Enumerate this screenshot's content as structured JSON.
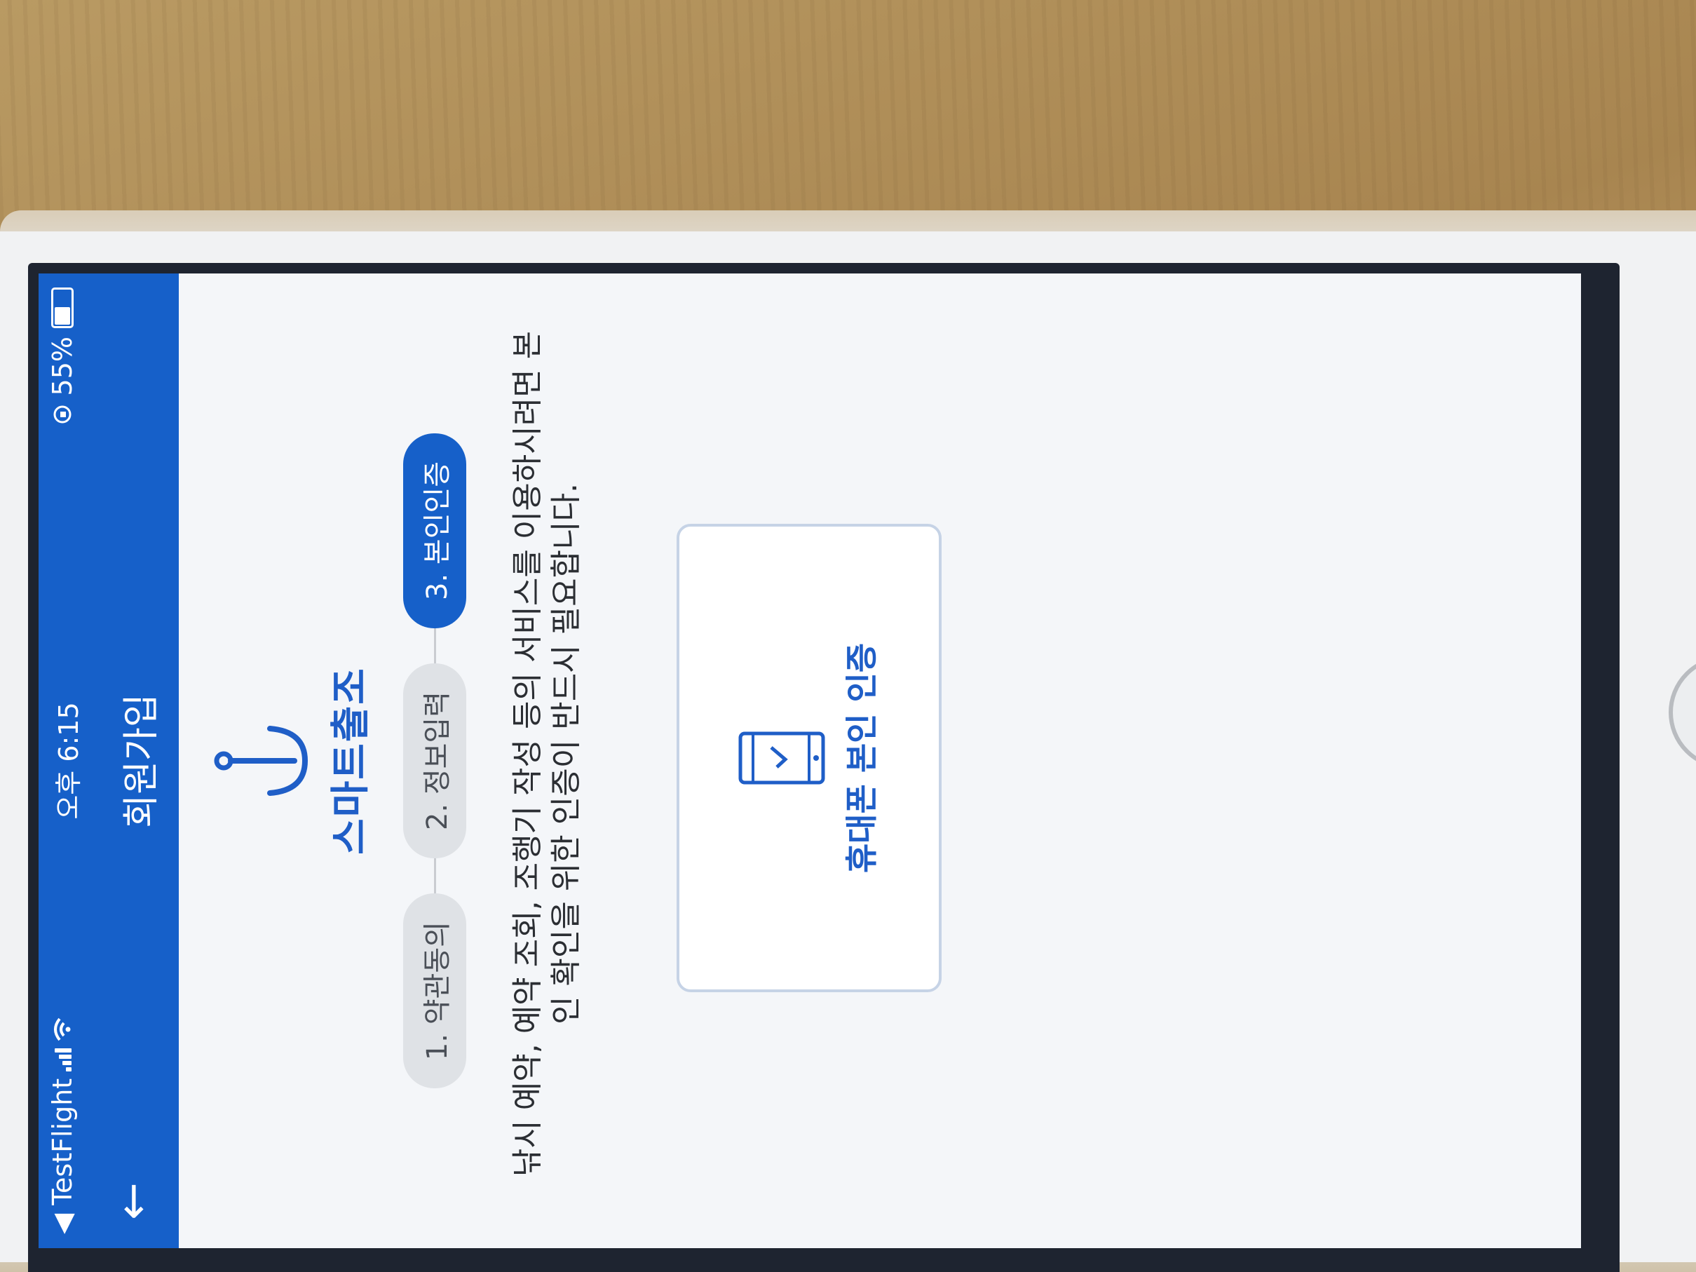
{
  "status_bar": {
    "back_app": "◀ TestFlight",
    "time": "오후 6:15",
    "battery_text": "55%",
    "battery_level": 0.55
  },
  "nav": {
    "back_icon": "←",
    "title": "회원가입"
  },
  "logo": {
    "text": "스마트출조",
    "icon_name": "anchor-icon"
  },
  "steps": [
    {
      "label": "1. 약관동의",
      "active": false
    },
    {
      "label": "2. 정보입력",
      "active": false
    },
    {
      "label": "3. 본인인증",
      "active": true
    }
  ],
  "description": "낚시 예약, 예약 조회, 조행기 작성 등의 서비스를 이용하시려면 본인 확인을 위한 인증이 반드시 필요합니다.",
  "verify_button": {
    "label": "휴대폰 본인 인증",
    "icon_name": "mobile-phone-icon"
  },
  "colors": {
    "primary": "#1660c9",
    "step_inactive": "#dfe2e6",
    "background": "#f4f6f9"
  }
}
